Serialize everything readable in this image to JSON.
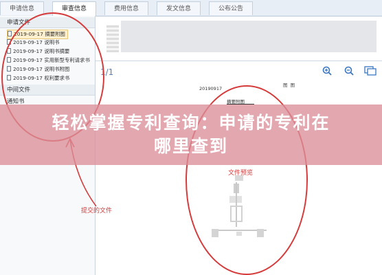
{
  "tabs": [
    "申请信息",
    "审查信息",
    "费用信息",
    "发文信息",
    "公布公告"
  ],
  "active_tab": "审查信息",
  "left_panel": {
    "section1_title": "申请文件",
    "files": [
      {
        "date": "2019-09-17",
        "name": "摘要附图"
      },
      {
        "date": "2019-09-17",
        "name": "说明书"
      },
      {
        "date": "2019-09-17",
        "name": "说明书摘要"
      },
      {
        "date": "2019-09-17",
        "name": "实用新型专利请求书"
      },
      {
        "date": "2019-09-17",
        "name": "说明书附图"
      },
      {
        "date": "2019-09-17",
        "name": "权利要求书"
      }
    ],
    "section2_title": "中间文件",
    "section3_title": "通知书"
  },
  "viewer": {
    "page_indicator": "1/1",
    "zoom_in_icon": "zoom-in-icon",
    "zoom_out_icon": "zoom-out-icon",
    "fit_icon": "fit-window-icon",
    "doc_date": "20190917",
    "doc_header_right": "图 图",
    "abstract_label": "摘要附图"
  },
  "annotations": {
    "submitted_files": "提交的文件",
    "file_preview": "文件预览"
  },
  "banner": {
    "line1": "轻松掌握专利查询：申请的专利在",
    "line2": "哪里查到"
  },
  "colors": {
    "annotation_red": "#d63b3b",
    "banner_bg": "#db8e98",
    "accent_blue": "#3a77c2"
  }
}
